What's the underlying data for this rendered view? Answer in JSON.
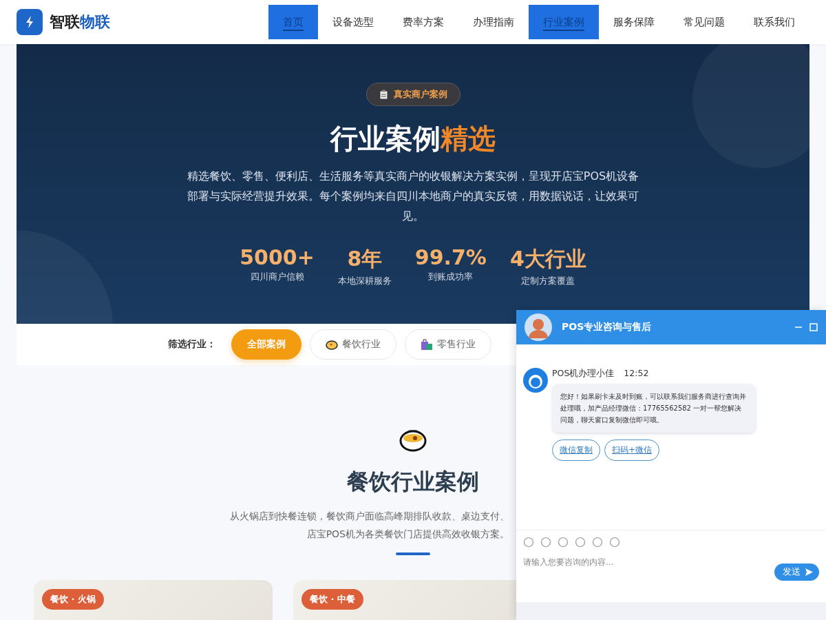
{
  "header": {
    "logo": {
      "part_1": "智联",
      "part_2": "物联"
    },
    "nav": [
      {
        "label": "首页",
        "selected": true
      },
      {
        "label": "设备选型",
        "selected": false
      },
      {
        "label": "费率方案",
        "selected": false
      },
      {
        "label": "办理指南",
        "selected": false
      },
      {
        "label": "行业案例",
        "selected": true
      },
      {
        "label": "服务保障",
        "selected": false
      },
      {
        "label": "常见问题",
        "selected": false
      },
      {
        "label": "联系我们",
        "selected": false
      }
    ]
  },
  "hero": {
    "badge": "真实商户案例",
    "title_part_1": "行业案例",
    "title_part_2": "精选",
    "description": "精选餐饮、零售、便利店、生活服务等真实商户的收银解决方案实例，呈现开店宝POS机设备部署与实际经营提升效果。每个案例均来自四川本地商户的真实反馈，用数据说话，让效果可见。",
    "stats": [
      {
        "value": "5000+",
        "label": "四川商户信赖"
      },
      {
        "value": "8年",
        "label": "本地深耕服务"
      },
      {
        "value": "99.7%",
        "label": "到账成功率"
      },
      {
        "value": "4大行业",
        "label": "定制方案覆盖"
      }
    ]
  },
  "filter": {
    "label": "筛选行业：",
    "chips": [
      {
        "label": "全部案例",
        "selected": true,
        "kind": "none"
      },
      {
        "label": "餐饮行业",
        "selected": false,
        "kind": "food"
      },
      {
        "label": "零售行业",
        "selected": false,
        "kind": "retail"
      }
    ]
  },
  "section": {
    "title": "餐饮行业案例",
    "description_line_1": "从火锅店到快餐连锁，餐饮商户面临高峰期排队收款、桌边支付、",
    "description_line_2": "店宝POS机为各类餐饮门店提供高效收银方案。",
    "cards": [
      {
        "tag": "餐饮 · 火锅"
      },
      {
        "tag": "餐饮 · 中餐"
      }
    ]
  },
  "chat": {
    "title": "POS专业咨询与售后",
    "agent": "POS机办理小佳",
    "time": "12:52",
    "message": "您好！如果刷卡未及时到账，可以联系我们服务商进行查询并处理哦，加产品经理微信：17765562582 一对一帮您解决问题，聊天窗口复制微信即可哦。",
    "actions": [
      "微信复制",
      "扫码+微信"
    ],
    "placeholder": "请输入您要咨询的内容...",
    "send": "发送"
  }
}
